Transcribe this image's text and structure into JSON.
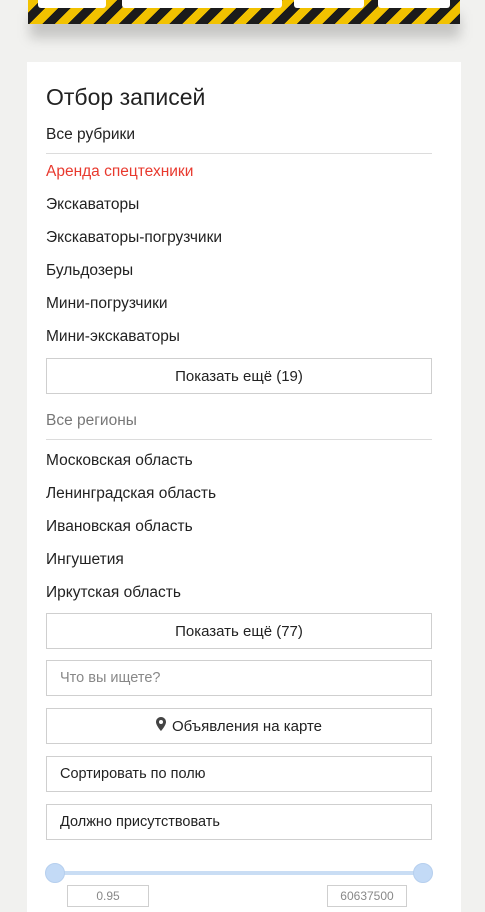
{
  "filter": {
    "title": "Отбор записей",
    "categories": {
      "all_label": "Все рубрики",
      "items": [
        {
          "label": "Аренда спецтехники",
          "active": true
        },
        {
          "label": "Экскаваторы",
          "active": false
        },
        {
          "label": "Экскаваторы-погрузчики",
          "active": false
        },
        {
          "label": "Бульдозеры",
          "active": false
        },
        {
          "label": "Мини-погрузчики",
          "active": false
        },
        {
          "label": "Мини-экскаваторы",
          "active": false
        }
      ],
      "show_more": "Показать ещё (19)"
    },
    "regions": {
      "all_label": "Все регионы",
      "items": [
        {
          "label": "Московская область"
        },
        {
          "label": "Ленинградская область"
        },
        {
          "label": "Ивановская область"
        },
        {
          "label": "Ингушетия"
        },
        {
          "label": "Иркутская область"
        }
      ],
      "show_more": "Показать ещё (77)"
    },
    "search": {
      "placeholder": "Что вы ищете?",
      "value": ""
    },
    "map_button": {
      "label": "Объявления на карте",
      "icon": "map-pin-icon"
    },
    "sort_select": {
      "label": "Сортировать по полю"
    },
    "must_have_select": {
      "label": "Должно присутствовать"
    },
    "range": {
      "min": "0.95",
      "max": "60637500"
    }
  },
  "colors": {
    "accent_active": "#e8392e",
    "slider": "#c3daf6",
    "banner_yellow": "#f2c200",
    "banner_black": "#1b1b1b"
  }
}
